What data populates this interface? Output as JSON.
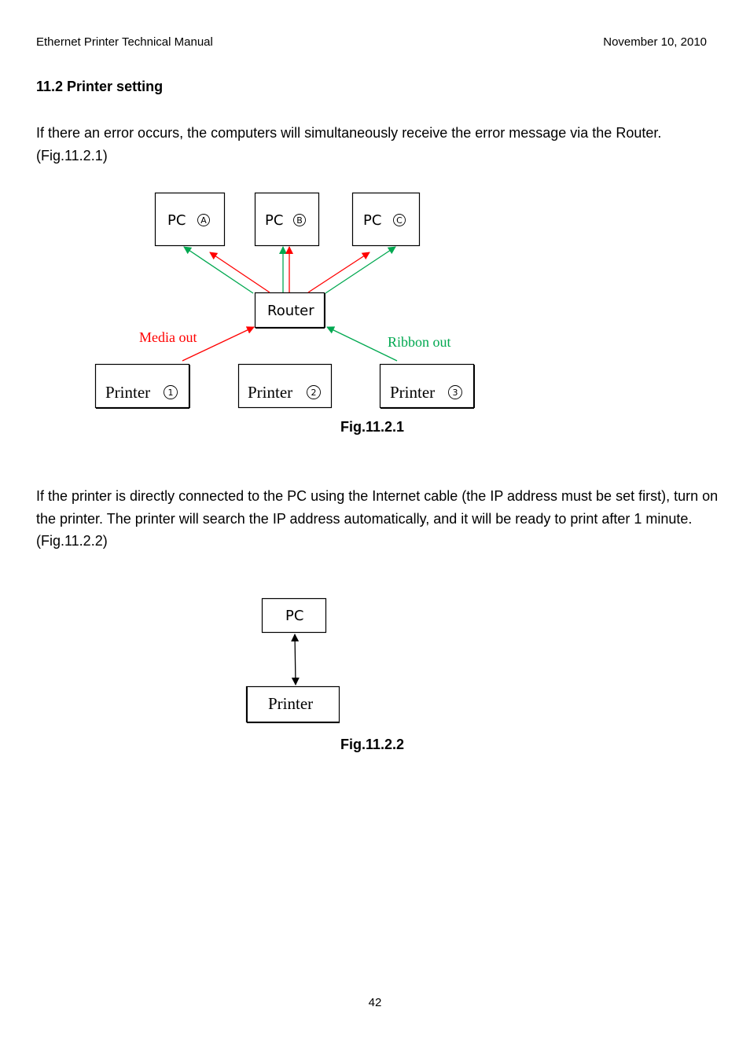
{
  "header": {
    "title": "Ethernet Printer Technical Manual",
    "date": "November 10, 2010"
  },
  "section": {
    "title": "11.2 Printer setting"
  },
  "paragraphs": [
    "If there an error occurs, the computers will simultaneously receive the error message via the Router. (Fig.11.2.1)",
    "If the printer is directly connected to the PC using the Internet cable (the IP address must be set first), turn on the printer. The printer will search the IP address automatically, and it will be ready to print after 1 minute. (Fig.11.2.2)"
  ],
  "figure1": {
    "caption": "Fig.11.2.1",
    "pcs": [
      {
        "label": "PC",
        "marker": "A"
      },
      {
        "label": "PC",
        "marker": "B"
      },
      {
        "label": "PC",
        "marker": "C"
      }
    ],
    "router": {
      "label": "Router"
    },
    "printers": [
      {
        "label": "Printer",
        "marker": "1"
      },
      {
        "label": "Printer",
        "marker": "2"
      },
      {
        "label": "Printer",
        "marker": "3"
      }
    ],
    "annotations": {
      "media_out": "Media out",
      "ribbon_out": "Ribbon out"
    },
    "colors": {
      "media_out": "#ff0000",
      "ribbon_out": "#00a850"
    }
  },
  "figure2": {
    "caption": "Fig.11.2.2",
    "pc": {
      "label": "PC"
    },
    "printer": {
      "label": "Printer"
    }
  },
  "footer": {
    "page_number": "42"
  }
}
